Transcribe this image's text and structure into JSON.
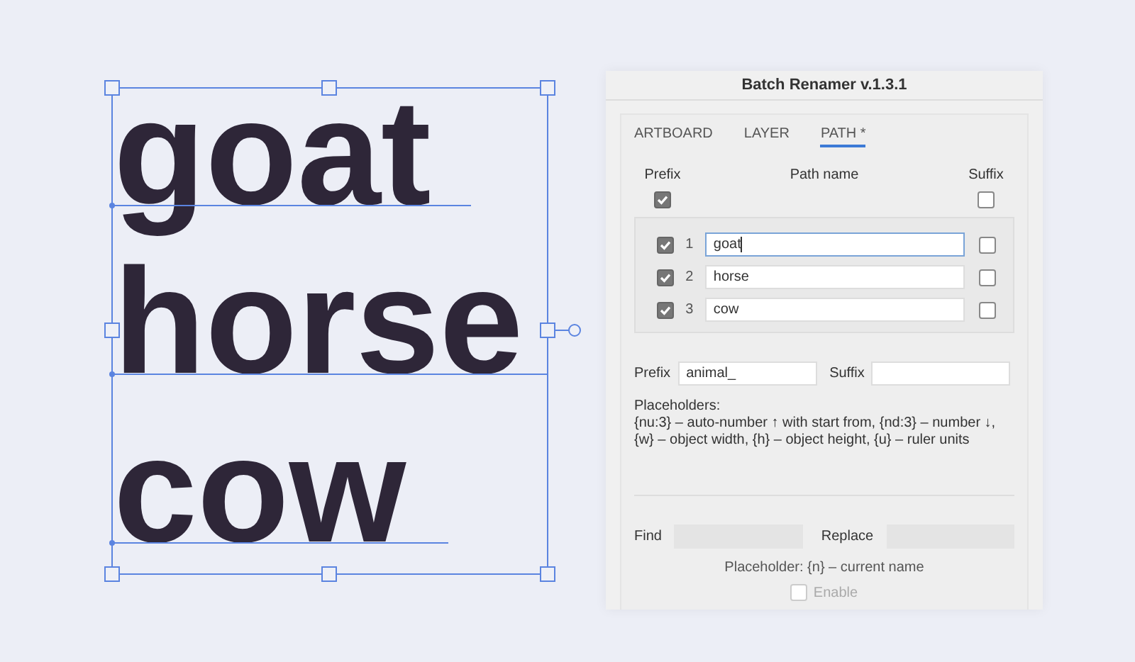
{
  "canvas": {
    "words": [
      {
        "text": "goat"
      },
      {
        "text": "horse"
      },
      {
        "text": "cow"
      }
    ]
  },
  "panel": {
    "title": "Batch Renamer v.1.3.1",
    "tabs": [
      {
        "label": "ARTBOARD",
        "selected": false
      },
      {
        "label": "LAYER",
        "selected": false
      },
      {
        "label": "PATH *",
        "selected": true
      }
    ],
    "header": {
      "prefix_label": "Prefix",
      "name_label": "Path name",
      "suffix_label": "Suffix",
      "prefix_all": true,
      "suffix_all": false
    },
    "rows": [
      {
        "number": "1",
        "name": "goat",
        "prefix": true,
        "suffix": false,
        "focused": true
      },
      {
        "number": "2",
        "name": "horse",
        "prefix": true,
        "suffix": false,
        "focused": false
      },
      {
        "number": "3",
        "name": "cow",
        "prefix": true,
        "suffix": false,
        "focused": false
      }
    ],
    "prefix": {
      "label": "Prefix",
      "value": "animal_"
    },
    "suffix": {
      "label": "Suffix"
    },
    "placeholders": [
      "Placeholders:",
      "{nu:3} – auto-number ↑ with start from, {nd:3} – number ↓,",
      "{w} – object width, {h} – object height, {u} – ruler units"
    ],
    "find": {
      "label": "Find"
    },
    "replace": {
      "label": "Replace"
    },
    "note": "Placeholder: {n} – current name",
    "enable": {
      "label": "Enable",
      "checked": false,
      "disabled": true
    }
  }
}
